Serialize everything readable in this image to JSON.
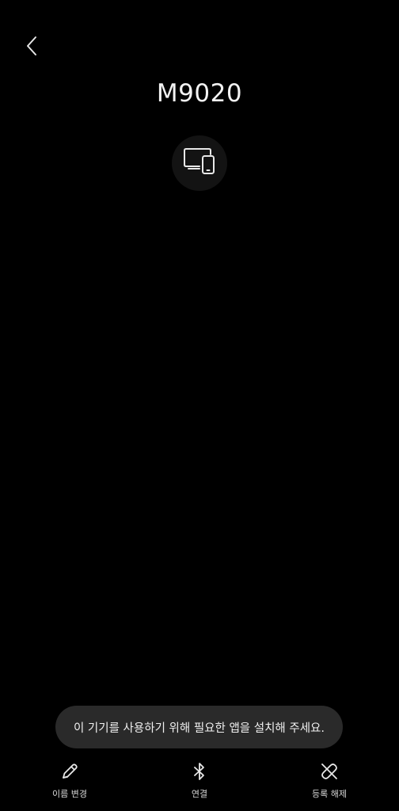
{
  "header": {
    "back_icon": "chevron-left-icon",
    "device_name": "M9020",
    "device_icon": "devices-icon"
  },
  "toast": {
    "message": "이 기기를 사용하기 위해 필요한 앱을 설치해 주세요."
  },
  "bottom_actions": [
    {
      "label": "이름 변경",
      "icon": "pencil-icon"
    },
    {
      "label": "연결",
      "icon": "bluetooth-icon"
    },
    {
      "label": "등록 해제",
      "icon": "unlink-icon"
    }
  ],
  "colors": {
    "background": "#000000",
    "icon_circle": "#131313",
    "toast_background": "#2a2a2a",
    "text": "#ffffff"
  }
}
